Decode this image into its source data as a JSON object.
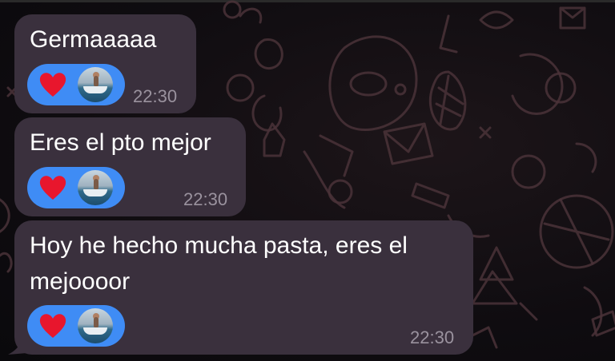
{
  "messages": [
    {
      "text_lines": [
        "Germaaaaa"
      ],
      "time": "22:30",
      "reaction": {
        "emoji_icon": "heart-icon",
        "avatar": "user-avatar"
      }
    },
    {
      "text_lines": [
        "Eres el pto mejor"
      ],
      "time": "22:30",
      "reaction": {
        "emoji_icon": "heart-icon",
        "avatar": "user-avatar"
      }
    },
    {
      "text_lines": [
        "Hoy he hecho mucha pasta, eres el",
        "mejoooor"
      ],
      "time": "22:30",
      "reaction": {
        "emoji_icon": "heart-icon",
        "avatar": "user-avatar"
      }
    }
  ],
  "colors": {
    "bubble": "#3a303d",
    "reaction_pill": "#3f8cf5",
    "heart": "#e8162d",
    "time": "#9a929e",
    "text": "#ffffff"
  }
}
